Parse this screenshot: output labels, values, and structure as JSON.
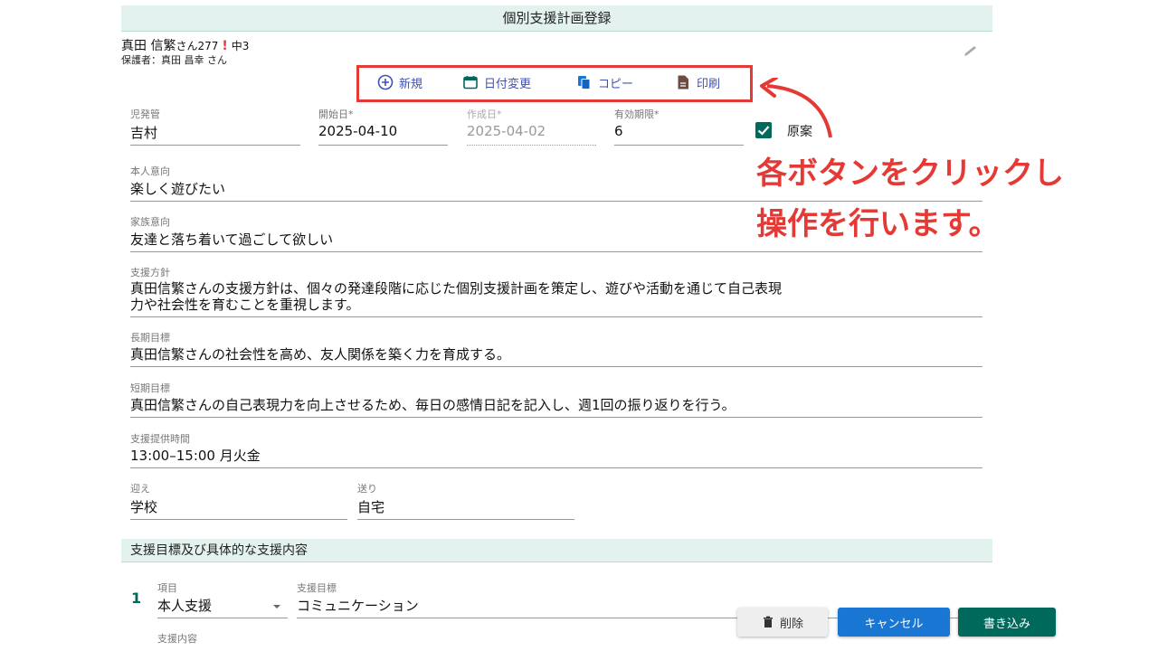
{
  "header": {
    "title": "個別支援計画登録"
  },
  "student": {
    "name": "真田 信繁",
    "honorific": "さん",
    "id": "277",
    "mark": "!",
    "grade": "中3",
    "guardian": "保護者：真田 昌幸 さん"
  },
  "toolbar": {
    "new_label": "新規",
    "date_change_label": "日付変更",
    "copy_label": "コピー",
    "print_label": "印刷"
  },
  "fields": {
    "manager": {
      "label": "児発管",
      "value": "吉村"
    },
    "start_date": {
      "label": "開始日",
      "value": "2025-04-10"
    },
    "created_date": {
      "label": "作成日",
      "value": "2025-04-02"
    },
    "validity": {
      "label": "有効期限",
      "value": "6"
    },
    "draft": {
      "label": "原案",
      "checked": true
    },
    "self_intent": {
      "label": "本人意向",
      "value": "楽しく遊びたい"
    },
    "family_intent": {
      "label": "家族意向",
      "value": "友達と落ち着いて過ごして欲しい"
    },
    "policy": {
      "label": "支援方針",
      "value_line1": "真田信繁さんの支援方針は、個々の発達段階に応じた個別支援計画を策定し、遊びや活動を通じて自己表現",
      "value_line2": "力や社会性を育むことを重視します。"
    },
    "long_goal": {
      "label": "長期目標",
      "value": "真田信繁さんの社会性を高め、友人関係を築く力を育成する。"
    },
    "short_goal": {
      "label": "短期目標",
      "value": "真田信繁さんの自己表現力を向上させるため、毎日の感情日記を記入し、週1回の振り返りを行う。"
    },
    "service_time": {
      "label": "支援提供時間",
      "value": "13:00–15:00 月火金"
    },
    "pickup": {
      "label": "迎え",
      "value": "学校"
    },
    "dropoff": {
      "label": "送り",
      "value": "自宅"
    }
  },
  "section": {
    "title": "支援目標及び具体的な支援内容",
    "row_number": "1",
    "item_label": "項目",
    "item_value": "本人支援",
    "goal_label": "支援目標",
    "goal_value": "コミュニケーション",
    "content_label": "支援内容"
  },
  "actions": {
    "delete_label": "削除",
    "cancel_label": "キャンセル",
    "save_label": "書き込み"
  },
  "annotation": {
    "line1": "各ボタンをクリックし",
    "line2": "操作を行います。"
  },
  "colors": {
    "accent_red": "#e53935",
    "teal": "#00695c",
    "blue": "#1976d2",
    "header_bg": "#e3f2ef"
  }
}
